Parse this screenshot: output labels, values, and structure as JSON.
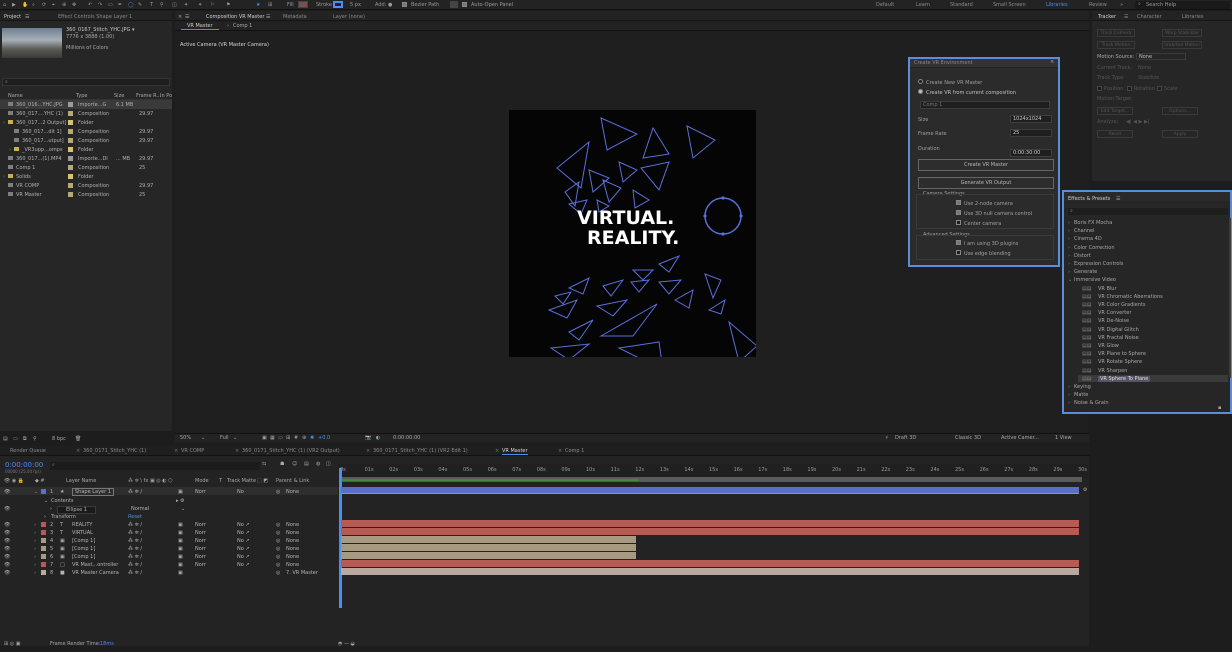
{
  "toolbar": {
    "fill": "Fill",
    "stroke": "Stroke",
    "stroke_width": "5 px",
    "add": "Add:",
    "bezier_path": "Bezier Path",
    "auto_open_panel": "Auto-Open Panel",
    "workspaces": [
      "Default",
      "Learn",
      "Standard",
      "Small Screen",
      "Libraries",
      "Review"
    ],
    "active_workspace": "Libraries",
    "search_help": "Search Help"
  },
  "project_panel": {
    "tabs": [
      "Project",
      "Effect Controls Shape Layer 1"
    ],
    "thumb_name": "360_0167_Stitch_YHC.JPG ▾",
    "thumb_dims": "7776 x 3888 (1.00)",
    "thumb_colors": "Millions of Colors",
    "columns": [
      "Name",
      "Type",
      "Size",
      "Frame R...",
      "In Po"
    ],
    "items": [
      {
        "name": "360_016...YHC.JPG",
        "type": "Importe...G",
        "size": "6.1 MB",
        "fr": "",
        "color": "#9b9b9b",
        "indent": 0,
        "selected": true,
        "icon": "image"
      },
      {
        "name": "360_017....YHC (1)",
        "type": "Composition",
        "size": "",
        "fr": "29.97",
        "color": "#b6a877",
        "indent": 0,
        "selected": false,
        "icon": "comp"
      },
      {
        "name": "360_017...2 Output]",
        "type": "Folder",
        "size": "",
        "fr": "",
        "color": "#d6c36d",
        "indent": 0,
        "selected": false,
        "icon": "folder"
      },
      {
        "name": "360_017...dit 1]",
        "type": "Composition",
        "size": "",
        "fr": "29.97",
        "color": "#b6a877",
        "indent": 1,
        "selected": false,
        "icon": "comp"
      },
      {
        "name": "360_017...utput]",
        "type": "Composition",
        "size": "",
        "fr": "29.97",
        "color": "#b6a877",
        "indent": 1,
        "selected": false,
        "icon": "comp"
      },
      {
        "name": "_VR3upp...omps",
        "type": "Folder",
        "size": "",
        "fr": "",
        "color": "#d6c36d",
        "indent": 1,
        "selected": false,
        "icon": "folder"
      },
      {
        "name": "360_017...(1).MP4",
        "type": "Importe...DI",
        "size": "... MB",
        "fr": "29.97",
        "color": "#9b9b9b",
        "indent": 0,
        "selected": false,
        "icon": "film"
      },
      {
        "name": "Comp 1",
        "type": "Composition",
        "size": "",
        "fr": "25",
        "color": "#b6a877",
        "indent": 0,
        "selected": false,
        "icon": "comp"
      },
      {
        "name": "Solids",
        "type": "Folder",
        "size": "",
        "fr": "",
        "color": "#d6c36d",
        "indent": 0,
        "selected": false,
        "icon": "folder"
      },
      {
        "name": "VR COMP",
        "type": "Composition",
        "size": "",
        "fr": "29.97",
        "color": "#b6a877",
        "indent": 0,
        "selected": false,
        "icon": "comp"
      },
      {
        "name": "VR Master",
        "type": "Composition",
        "size": "",
        "fr": "25",
        "color": "#b6a877",
        "indent": 0,
        "selected": false,
        "icon": "comp"
      }
    ],
    "footer_bpc": "8 bpc"
  },
  "composition_panel": {
    "tabs": [
      "Composition VR Master",
      "Metadata",
      "Layer (none)"
    ],
    "subtabs": [
      "VR Master",
      "Comp 1"
    ],
    "active_camera_label": "Active Camera (VR Master Camera)",
    "canvas_text_line1": "VIRTUAL.",
    "canvas_text_line2": "REALITY.",
    "zoom": "50%",
    "resolution": "Full",
    "exposure": "+0.0",
    "timecode": "0:00:00:00",
    "renderer": "Draft 3D",
    "renderer_mode": "Classic 3D",
    "camera_select": "Active Camer...",
    "view_layout": "1 View"
  },
  "vr_dialog": {
    "title": "Create VR Environment",
    "option_new": "Create New VR Master",
    "option_current": "Create VR from current composition",
    "comp_select": "Comp 1",
    "size_label": "Size",
    "size_value": "1024x1024",
    "frame_rate_label": "Frame Rate",
    "frame_rate_value": "25",
    "duration_label": "Duration",
    "duration_value": "0:00:30:00",
    "create_master_btn": "Create VR Master",
    "generate_output_btn": "Generate VR Output",
    "camera_settings_label": "Camera Settings",
    "cam_opts": [
      {
        "label": "Use 2-node camera",
        "checked": true
      },
      {
        "label": "Use 3D null camera control",
        "checked": true
      },
      {
        "label": "Center camera",
        "checked": false
      }
    ],
    "advanced_label": "Advanced Settings",
    "adv_opts": [
      {
        "label": "I am using 3D plugins",
        "checked": true
      },
      {
        "label": "Use edge blending",
        "checked": false
      }
    ]
  },
  "tracker_panel": {
    "tabs": [
      "Tracker",
      "Character",
      "Libraries"
    ],
    "buttons": [
      "Track Camera",
      "Warp Stabilizer",
      "Track Motion",
      "Stabilize Motion"
    ],
    "motion_source_label": "Motion Source:",
    "motion_source_value": "None",
    "current_track_label": "Current Track:",
    "current_track_value": "None",
    "track_type_label": "Track Type:",
    "track_type_value": "Stabilize",
    "checks": [
      "Position",
      "Rotation",
      "Scale"
    ],
    "motion_target_label": "Motion Target:",
    "edit_target": "Edit Target...",
    "options": "Options...",
    "analyze_label": "Analyze:",
    "reset": "Reset",
    "apply": "Apply"
  },
  "effects_panel": {
    "title": "Effects & Presets",
    "categories": [
      "Boris FX Mocha",
      "Channel",
      "Cinema 4D",
      "Color Correction",
      "Distort",
      "Expression Controls",
      "Generate",
      "Immersive Video"
    ],
    "immersive_items": [
      "VR Blur",
      "VR Chromatic Aberrations",
      "VR Color Gradients",
      "VR Converter",
      "VR De-Noise",
      "VR Digital Glitch",
      "VR Fractal Noise",
      "VR Glow",
      "VR Plane to Sphere",
      "VR Rotate Sphere",
      "VR Sharpen",
      "VR Sphere To Plane"
    ],
    "more_categories": [
      "Keying",
      "Matte",
      "Noise & Grain"
    ]
  },
  "timeline": {
    "tabs": [
      "Render Queue",
      "360_0171_Stitch_YHC (1)",
      "VR COMP",
      "360_0171_Stitch_YHC (1) (VR2 Output)",
      "360_0171_Stitch_YHC (1) (VR2 Edit 1)",
      "VR Master",
      "Comp 1"
    ],
    "active_tab": "VR Master",
    "timecode": "0:00:00:00",
    "timecode_sub": "00000 (25.00 fps)",
    "headers": {
      "layer_name": "Layer Name",
      "mode": "Mode",
      "t": "T",
      "track_matte": "Track Matte",
      "parent": "Parent & Link"
    },
    "ruler": [
      "0s",
      "01s",
      "02s",
      "03s",
      "04s",
      "05s",
      "06s",
      "07s",
      "08s",
      "09s",
      "10s",
      "11s",
      "12s",
      "13s",
      "14s",
      "15s",
      "16s",
      "17s",
      "18s",
      "19s",
      "20s",
      "21s",
      "22s",
      "23s",
      "24s",
      "25s",
      "26s",
      "27s",
      "28s",
      "29s",
      "30s"
    ],
    "layers": [
      {
        "num": "1",
        "name": "Shape Layer 1",
        "mode": "Norr",
        "matte": "No",
        "parent": "None",
        "color": "#5a6fc8",
        "type": "★",
        "selected": true,
        "bar_end": 1.0
      },
      {
        "num": "2",
        "name": "REALITY",
        "mode": "Norr",
        "matte": "No ↗",
        "parent": "None",
        "color": "#b65a52",
        "type": "T",
        "selected": false,
        "bar_end": 1.0
      },
      {
        "num": "3",
        "name": "VIRTUAL",
        "mode": "Norr",
        "matte": "No ↗",
        "parent": "None",
        "color": "#b65a52",
        "type": "T",
        "selected": false,
        "bar_end": 1.0
      },
      {
        "num": "4",
        "name": "[Comp 1]",
        "mode": "Norr",
        "matte": "No ↗",
        "parent": "None",
        "color": "#a89a80",
        "type": "▣",
        "selected": false,
        "bar_end": 0.4
      },
      {
        "num": "5",
        "name": "[Comp 1]",
        "mode": "Norr",
        "matte": "No ↗",
        "parent": "None",
        "color": "#a89a80",
        "type": "▣",
        "selected": false,
        "bar_end": 0.4
      },
      {
        "num": "6",
        "name": "[Comp 1]",
        "mode": "Norr",
        "matte": "No ↗",
        "parent": "None",
        "color": "#a89a80",
        "type": "▣",
        "selected": false,
        "bar_end": 0.4
      },
      {
        "num": "7",
        "name": "VR Mast...ontroller",
        "mode": "Norr",
        "matte": "No ↗",
        "parent": "None",
        "color": "#b65a52",
        "type": "□",
        "selected": false,
        "bar_end": 1.0
      },
      {
        "num": "8",
        "name": "VR Master Camera",
        "mode": "",
        "matte": "",
        "parent": "7. VR Master",
        "color": "#b8a8a0",
        "type": "■",
        "selected": false,
        "bar_end": 1.0
      }
    ],
    "contents_label": "Contents",
    "ellipse_label": "Ellipse 1",
    "ellipse_mode": "Normal",
    "transform_label": "Transform",
    "transform_reset": "Reset",
    "frame_render_label": "Frame Render Time:",
    "frame_render_value": "18ms"
  },
  "colors": {
    "accent": "#4a8ff0",
    "selection_blue": "#5a6fc8",
    "layer_red": "#b65a52",
    "layer_tan": "#a89a80",
    "dialog_border": "#5a8fd8"
  }
}
